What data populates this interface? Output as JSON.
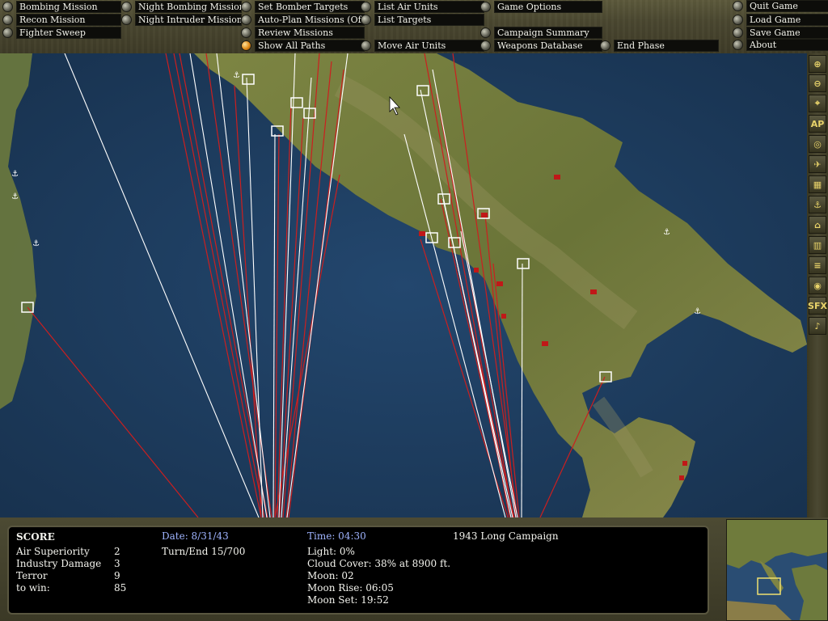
{
  "menu": {
    "bombing_mission": "Bombing Mission",
    "recon_mission": "Recon Mission",
    "fighter_sweep": "Fighter Sweep",
    "night_bombing_mission": "Night Bombing Mission",
    "night_intruder_mission": "Night Intruder Mission",
    "set_bomber_targets": "Set Bomber Targets",
    "auto_plan_missions": "Auto-Plan Missions (Off)",
    "review_missions": "Review Missions",
    "show_all_paths": "Show All Paths",
    "list_air_units": "List Air Units",
    "list_targets": "List Targets",
    "move_air_units": "Move Air Units",
    "game_options": "Game Options",
    "campaign_summary": "Campaign Summary",
    "weapons_database": "Weapons Database",
    "end_phase": "End Phase",
    "quit_game": "Quit Game",
    "load_game": "Load Game",
    "save_game": "Save Game",
    "about": "About"
  },
  "toolbar": {
    "buttons": [
      "zoom-in",
      "zoom-out",
      "center",
      "AP",
      "target",
      "aircraft",
      "factory",
      "anchor",
      "bridge",
      "building",
      "train",
      "target-2",
      "SFX",
      "music"
    ],
    "ap_label": "AP",
    "sfx_label": "SFX"
  },
  "status": {
    "score_label": "SCORE",
    "air_superiority_label": "Air Superiority",
    "air_superiority_value": "2",
    "industry_damage_label": "Industry Damage",
    "industry_damage_value": "3",
    "terror_label": "Terror",
    "terror_value": "9",
    "to_win_label": "to win:",
    "to_win_value": "85",
    "date": "Date: 8/31/43",
    "turn_end": "Turn/End 15/700",
    "time": "Time: 04:30",
    "light": "Light: 0%",
    "cloud_cover": "Cloud Cover: 38% at 8900 ft.",
    "moon": "Moon: 02",
    "moon_rise": "Moon Rise: 06:05",
    "moon_set": "Moon Set: 19:52",
    "campaign": "1943 Long Campaign"
  },
  "colors": {
    "sea": "#1f3b5c",
    "land": "#6f7a3c",
    "path_red": "#cc1f1f",
    "path_white": "#ffffff",
    "status_blue": "#9fb4ff",
    "active_button": "#e08a18"
  }
}
